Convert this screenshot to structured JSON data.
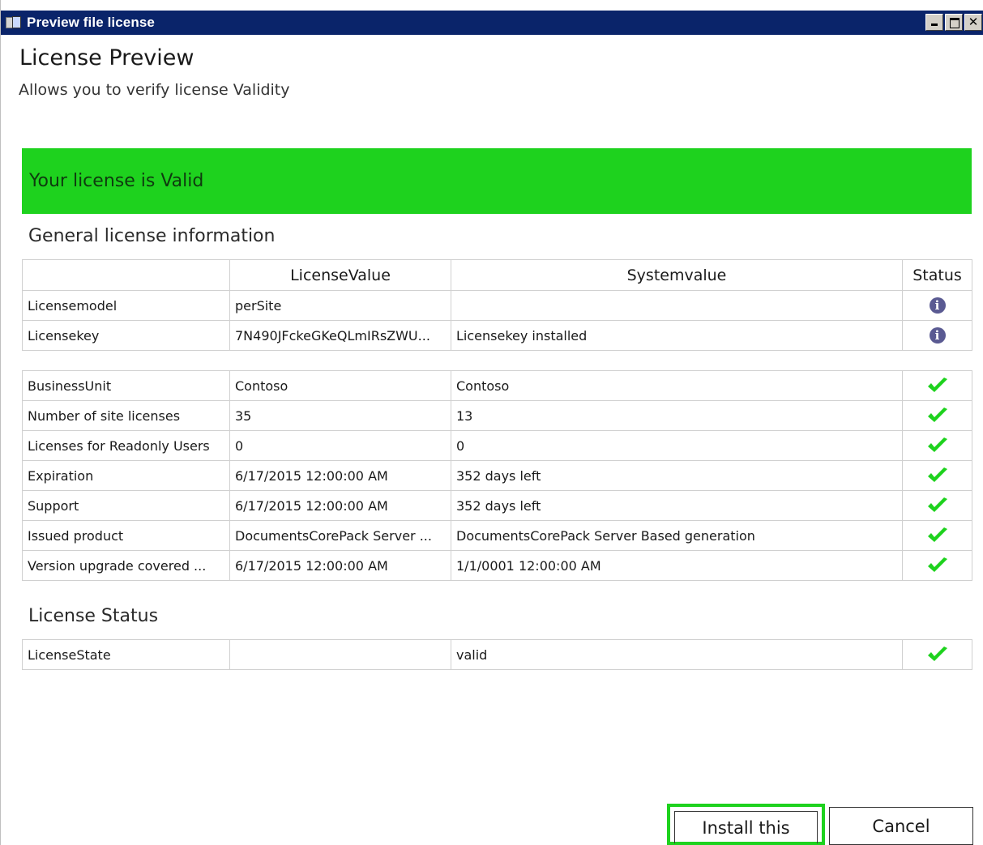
{
  "window": {
    "title": "Preview file license",
    "controls": [
      "minimize-icon",
      "maximize-icon",
      "close-icon"
    ],
    "close_glyph": "✕"
  },
  "header": {
    "title": "License Preview",
    "subtitle": "Allows you to verify license Validity"
  },
  "banner": {
    "text": "Your license is Valid",
    "color": "#1ed21e"
  },
  "general": {
    "title": "General license information",
    "columns": [
      "",
      "LicenseValue",
      "Systemvalue",
      "Status"
    ],
    "rows_info": [
      {
        "name": "Licensemodel",
        "license": "perSite",
        "system": "",
        "status": "info-icon"
      },
      {
        "name": "Licensekey",
        "license": "7N490JFckeGKeQLmIRsZWU...",
        "system": "Licensekey installed",
        "status": "info-icon"
      }
    ],
    "rows_check": [
      {
        "name": "BusinessUnit",
        "license": "Contoso",
        "system": "Contoso",
        "status": "check-icon"
      },
      {
        "name": "Number of site licenses",
        "license": "35",
        "system": "13",
        "status": "check-icon"
      },
      {
        "name": "Licenses for Readonly Users",
        "license": "0",
        "system": "0",
        "status": "check-icon"
      },
      {
        "name": "Expiration",
        "license": "6/17/2015 12:00:00 AM",
        "system": "352 days left",
        "status": "check-icon"
      },
      {
        "name": "Support",
        "license": "6/17/2015 12:00:00 AM",
        "system": "352 days left",
        "status": "check-icon"
      },
      {
        "name": "Issued product",
        "license": "DocumentsCorePack Server ...",
        "system": "DocumentsCorePack Server Based generation",
        "status": "check-icon"
      },
      {
        "name": "Version upgrade covered ...",
        "license": "6/17/2015 12:00:00 AM",
        "system": "1/1/0001 12:00:00 AM",
        "status": "check-icon"
      }
    ]
  },
  "license_status": {
    "title": "License Status",
    "rows": [
      {
        "name": "LicenseState",
        "license": "",
        "system": "valid",
        "status": "check-icon"
      }
    ]
  },
  "buttons": {
    "install": "Install this",
    "cancel": "Cancel"
  },
  "colors": {
    "titlebar": "#0a246a",
    "check": "#1ed21e",
    "info": "#5a5a92"
  }
}
